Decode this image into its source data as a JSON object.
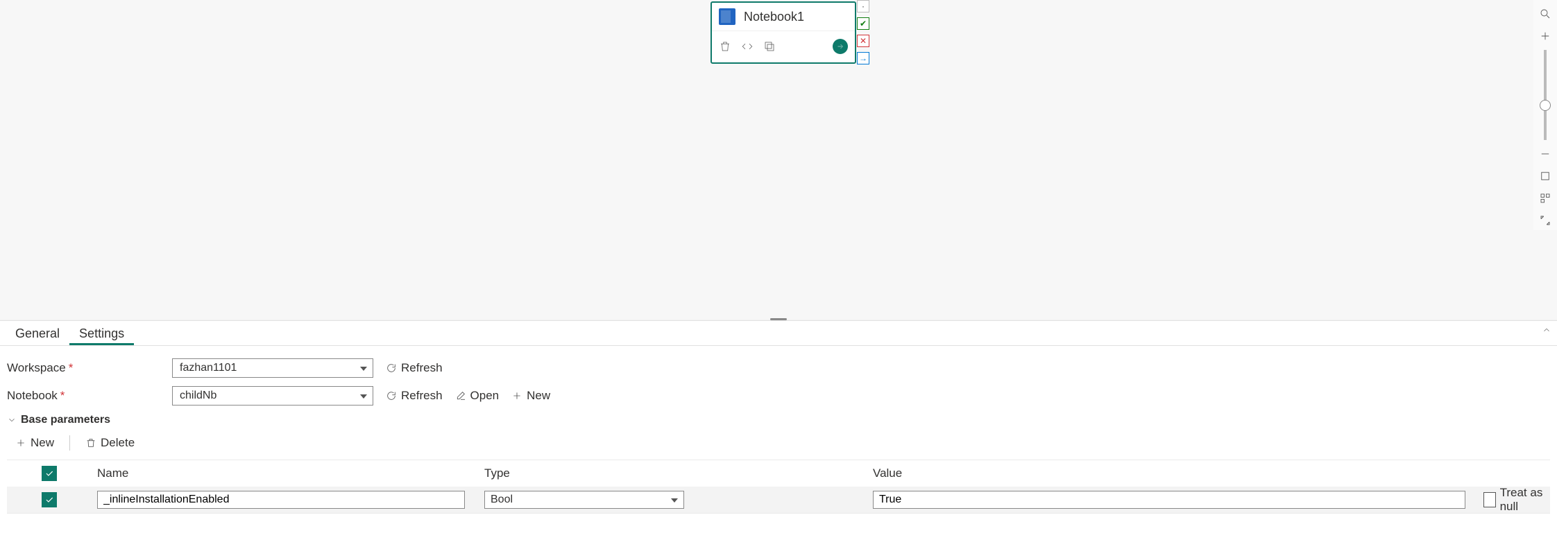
{
  "node": {
    "title": "Notebook1"
  },
  "tabs": {
    "general": "General",
    "settings": "Settings"
  },
  "form": {
    "workspace_label": "Workspace",
    "notebook_label": "Notebook",
    "workspace_value": "fazhan1101",
    "notebook_value": "childNb",
    "refresh": "Refresh",
    "open": "Open",
    "new": "New"
  },
  "params": {
    "section": "Base parameters",
    "new": "New",
    "delete": "Delete",
    "headers": {
      "name": "Name",
      "type": "Type",
      "value": "Value"
    },
    "treat_null": "Treat as null",
    "rows": [
      {
        "name": "_inlineInstallationEnabled",
        "type": "Bool",
        "value": "True",
        "treat_null": false
      }
    ]
  }
}
